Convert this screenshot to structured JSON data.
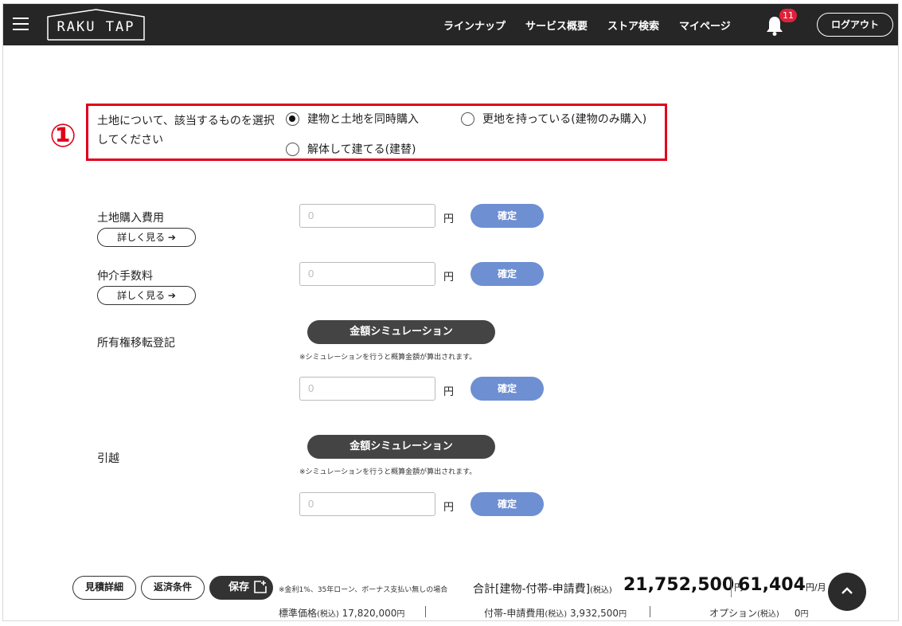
{
  "header": {
    "menu_icon": "hamburger-menu-icon",
    "logo_text": "RAKU TAP",
    "nav": [
      "ラインナップ",
      "サービス概要",
      "ストア検索",
      "マイページ"
    ],
    "notification_count": "11",
    "bell_icon": "bell-icon",
    "logout_label": "ログアウト"
  },
  "land": {
    "marker": "①",
    "label": "土地について、該当するものを選択してください",
    "options": [
      "建物と土地を同時購入",
      "更地を持っている(建物のみ購入)",
      "解体して建てる(建替)"
    ],
    "selected_index": 0,
    "highlight_color": "#e1001a"
  },
  "rows": {
    "land_cost": {
      "label": "土地購入費用",
      "more_label": "詳しく見る ➔",
      "placeholder": "0",
      "yen": "円",
      "confirm_label": "確定"
    },
    "brokerage": {
      "label": "仲介手数料",
      "more_label": "詳しく見る ➔",
      "placeholder": "0",
      "yen": "円",
      "confirm_label": "確定"
    },
    "registration": {
      "label": "所有権移転登記",
      "sim_label": "金額シミュレーション",
      "sim_note": "※シミュレーションを行うと概算金額が算出されます。",
      "placeholder": "0",
      "yen": "円",
      "confirm_label": "確定"
    },
    "moving": {
      "label": "引越",
      "sim_label": "金額シミュレーション",
      "sim_note": "※シミュレーションを行うと概算金額が算出されます。",
      "placeholder": "0",
      "yen": "円",
      "confirm_label": "確定"
    }
  },
  "accent_color": "#6e8fd2",
  "footer": {
    "estimate_detail": "見積詳細",
    "repayment_terms": "返済条件",
    "save_label": "保存",
    "save_icon": "save-plus-icon",
    "loan_note": "※金利1%、35年ローン、ボーナス支払い無しの場合",
    "total_label": "合計[建物-付帯-申請費]",
    "tax_incl": "(税込)",
    "total_value": "21,752,500",
    "yen": "円",
    "monthly_value": "61,404",
    "per_month": "円/月",
    "standard_price_label": "標準価格",
    "standard_price_value": "17,820,000",
    "incidental_label": "付帯-申請費用",
    "incidental_value": "3,932,500",
    "option_label": "オプション",
    "option_value": "0",
    "scroll_top_icon": "chevron-up-icon"
  }
}
